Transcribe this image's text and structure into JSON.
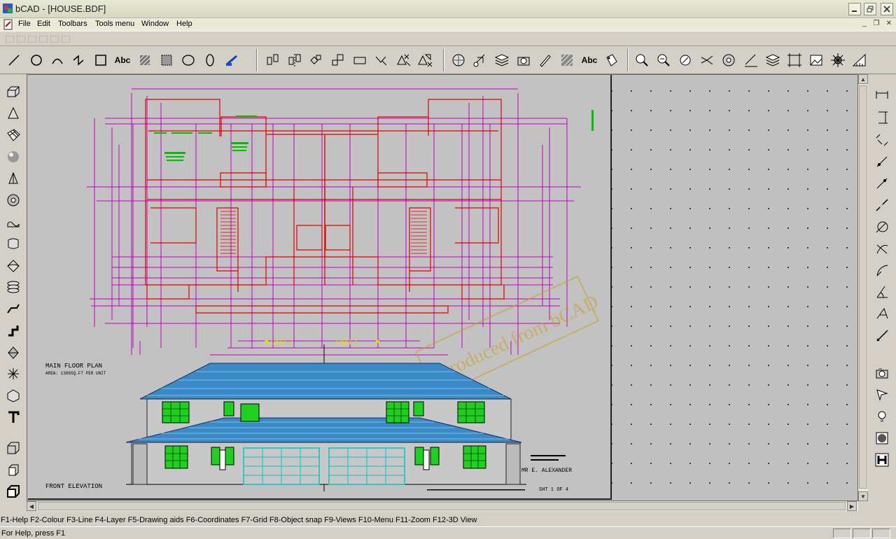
{
  "window": {
    "title": "bCAD - [HOUSE.BDF]",
    "minimize_icon": "minimize-icon",
    "maximize_icon": "restore-icon",
    "close_icon": "close-icon"
  },
  "menu": {
    "items": [
      "File",
      "Edit",
      "Toolbars",
      "Tools menu",
      "Window",
      "Help"
    ]
  },
  "toolbar": {
    "draw_tools": [
      "line",
      "circle",
      "arc",
      "polyline",
      "rectangle",
      "text",
      "hatch",
      "region",
      "ellipse",
      "ellipse-2",
      "paint"
    ],
    "text_tool_label": "Abc",
    "modify_tools": [
      "copy",
      "mirror",
      "rotate",
      "scale",
      "stretch",
      "trim",
      "move-copy",
      "array"
    ],
    "property_tools": [
      "layers",
      "snap",
      "objects",
      "camera",
      "edit",
      "pattern",
      "edit-text",
      "attribute"
    ],
    "text_tool_label_2": "Abc",
    "view_tools": [
      "zoom-window",
      "zoom-previous",
      "zoom-all",
      "pan",
      "render",
      "measure",
      "layer-manager",
      "frame",
      "image",
      "settings",
      "ruler"
    ]
  },
  "palettes": {
    "left": [
      "box",
      "cone",
      "surface-mesh",
      "sphere",
      "pyramid",
      "torus",
      "extrude",
      "revolve",
      "loft",
      "layers-3d",
      "sweep",
      "solid-line",
      "cut",
      "array-3d",
      "polyhedron",
      "text-3d",
      "view-1",
      "view-2",
      "view-3"
    ],
    "right": [
      "dim-horizontal",
      "dim-vertical",
      "dim-aligned",
      "dim-angle-1",
      "dim-angle-2",
      "dim-linear",
      "dim-radius",
      "dim-diameter",
      "dim-arc",
      "dim-angle",
      "dim-leader",
      "dim-ordinate",
      "camera",
      "light-spot",
      "light-bulb",
      "shade",
      "render-view"
    ]
  },
  "drawing": {
    "unit_labels": [
      "UNIT 2",
      "UNIT 1"
    ],
    "plan_title": "MAIN FLOOR PLAN",
    "plan_subtitle": "AREA: 1386SQ.FT PER UNIT",
    "elevation_title": "FRONT ELEVATION",
    "client": "MR E. ALEXANDER",
    "sheet": "SHT 1 OF 4",
    "watermark": "produced from bCAD"
  },
  "fkeys": "F1-Help F2-Colour F3-Line F4-Layer F5-Drawing aids F6-Coordinates F7-Grid F8-Object snap F9-Views F10-Menu F11-Zoom F12-3D View",
  "status": "For Help, press F1",
  "colors": {
    "plan_walls": "#e00000",
    "dimensions": "#c000c0",
    "plan_text": "#00c000",
    "labels": "#e0e000",
    "roof": "#3a8ac8",
    "garage": "#00c8c8",
    "windows": "#20d020"
  }
}
